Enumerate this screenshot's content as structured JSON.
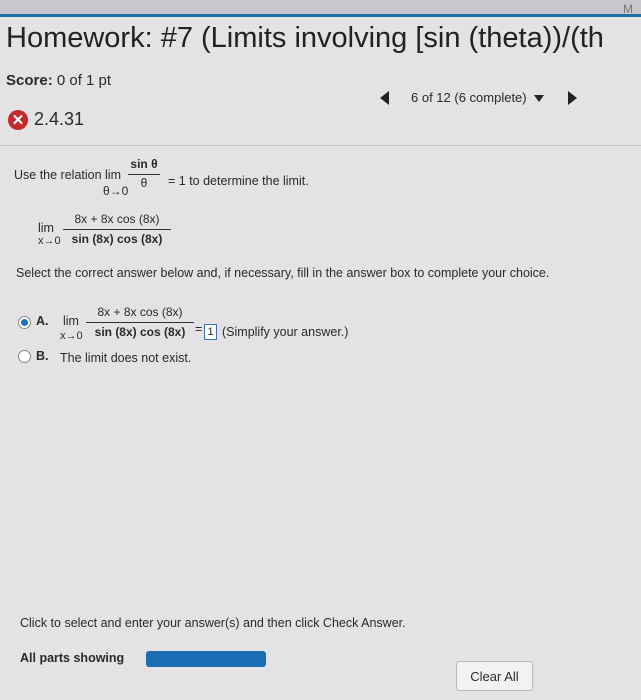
{
  "header": {
    "corner_letter": "M",
    "title": "Homework: #7 (Limits involving [sin (theta))/(th",
    "score_label": "Score:",
    "score_value": " 0 of 1 pt",
    "nav_text": "6 of 12 (6 complete)"
  },
  "question": {
    "id": "2.4.31",
    "status_icon": "x-icon",
    "relation_prefix": "Use the relation  lim",
    "relation_num": "sin θ",
    "relation_den": "θ",
    "relation_sub": "θ→0",
    "relation_suffix": "= 1 to determine the limit.",
    "limit_word": "lim",
    "limit_sub": "x→0",
    "limit_num": "8x + 8x cos (8x)",
    "limit_den": "sin (8x) cos (8x)",
    "instruction": "Select the correct answer below and, if necessary, fill in the answer box to complete your choice."
  },
  "choices": {
    "a_letter": "A.",
    "a_lim": "lim",
    "a_sub": "x→0",
    "a_num": "8x + 8x cos (8x)",
    "a_den": "sin (8x) cos (8x)",
    "a_equals": "=",
    "a_answer": "1",
    "a_hint": "(Simplify your answer.)",
    "b_letter": "B.",
    "b_text": "The limit does not exist."
  },
  "footer": {
    "instruction": "Click to select and enter your answer(s) and then click Check Answer.",
    "all_parts": "All parts showing",
    "progress": 1.0,
    "clear_all": "Clear All"
  },
  "colors": {
    "accent": "#1b6db4",
    "error": "#c42a2a"
  }
}
